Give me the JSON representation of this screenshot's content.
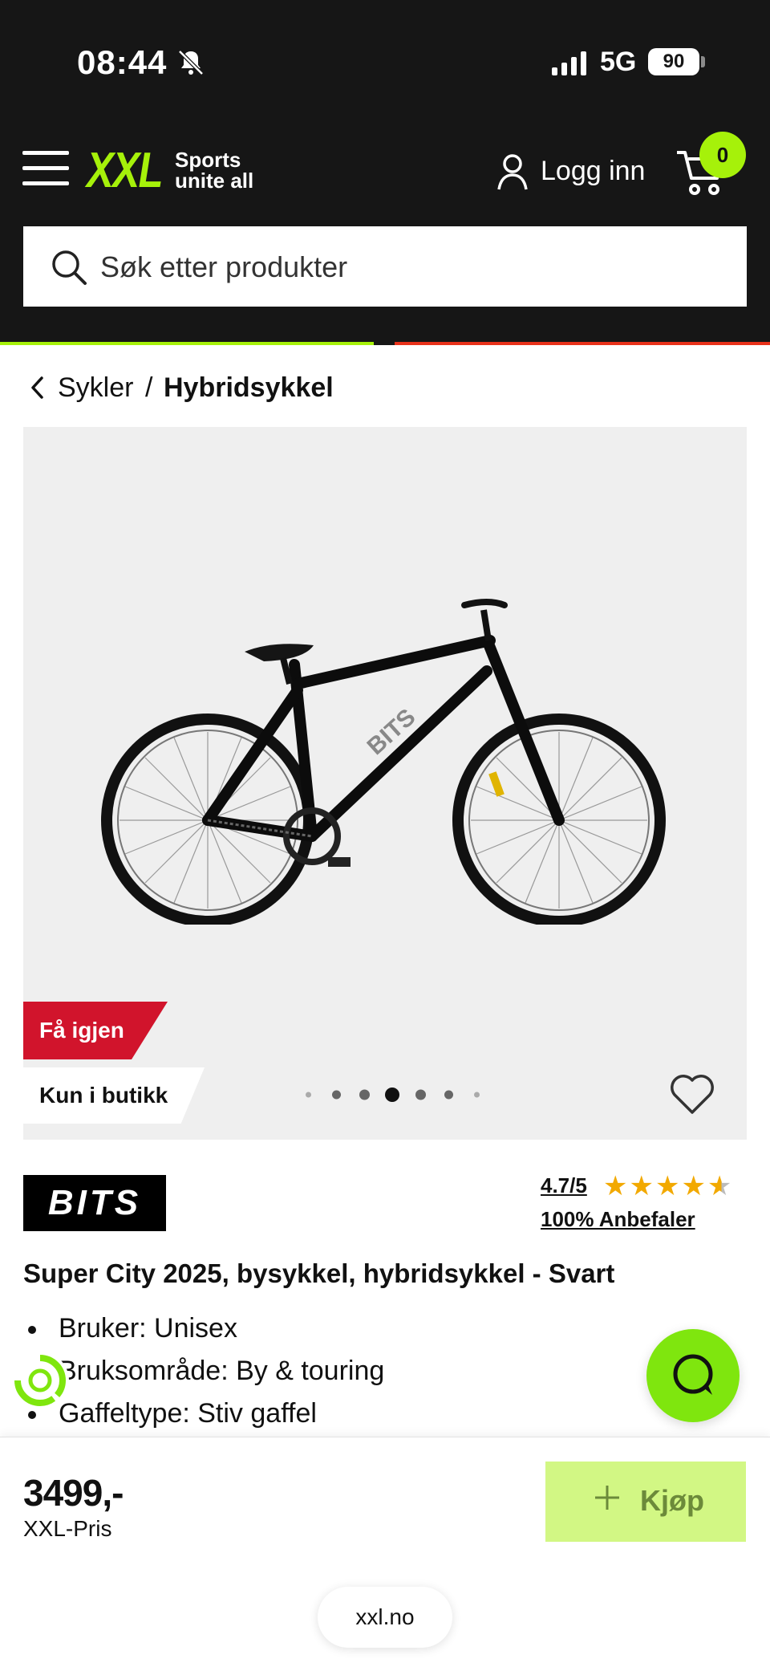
{
  "status_bar": {
    "time": "08:44",
    "network": "5G",
    "battery": "90"
  },
  "header": {
    "logo": "XXL",
    "logo_tagline": "Sports unite all",
    "login_label": "Logg inn",
    "cart_count": "0",
    "search_placeholder": "Søk etter produkter"
  },
  "breadcrumb": {
    "parent": "Sykler",
    "separator": "/",
    "current": "Hybridsykkel"
  },
  "gallery": {
    "badge_primary": "Få igjen",
    "badge_secondary": "Kun i butikk",
    "image_count": 7,
    "active_index": 3
  },
  "product": {
    "brand": "BITS",
    "rating_score": "4.7/5",
    "rating_value": 4.7,
    "recommend": "100% Anbefaler",
    "title": "Super City 2025, bysykkel, hybridsykkel - Svart",
    "features": [
      "Bruker: Unisex",
      "Bruksområde: By & touring",
      "Gaffeltype: Stiv gaffel"
    ]
  },
  "purchase": {
    "price": "3499,-",
    "price_label": "XXL-Pris",
    "buy_label": "Kjøp"
  },
  "browser": {
    "url": "xxl.no"
  },
  "colors": {
    "header_bg": "#161616",
    "brand_green": "#a6f10a",
    "badge_red": "#d1142c",
    "buy_bg": "#d2f784"
  },
  "icons": [
    "hamburger-icon",
    "user-icon",
    "cart-icon",
    "search-icon",
    "chevron-left-icon",
    "heart-icon",
    "chat-icon",
    "plus-icon",
    "eco-icon"
  ]
}
